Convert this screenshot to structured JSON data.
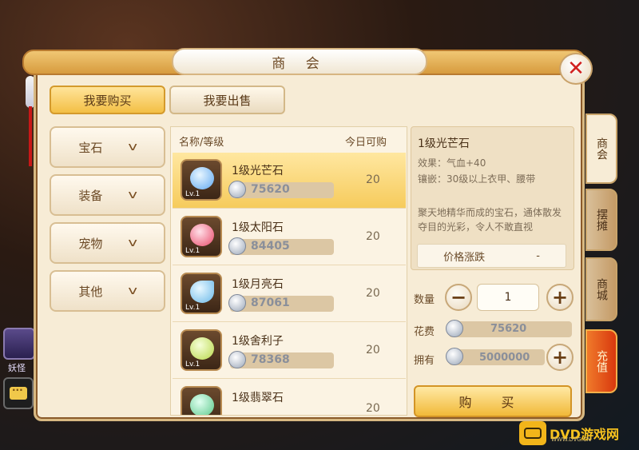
{
  "window": {
    "title": "商 会",
    "close_icon": "close-icon"
  },
  "top_tabs": {
    "buy": "我要购买",
    "sell": "我要出售"
  },
  "categories": [
    {
      "label": "宝石"
    },
    {
      "label": "装备"
    },
    {
      "label": "宠物"
    },
    {
      "label": "其他"
    }
  ],
  "list": {
    "header_name": "名称/等级",
    "header_qty": "今日可购",
    "items": [
      {
        "name": "1级光芒石",
        "price": "75620",
        "qty": "20",
        "level": "Lv.1",
        "color": "#5fa8f0"
      },
      {
        "name": "1级太阳石",
        "price": "84405",
        "qty": "20",
        "level": "Lv.1",
        "color": "#e84a6a"
      },
      {
        "name": "1级月亮石",
        "price": "87061",
        "qty": "20",
        "level": "Lv.1",
        "color": "#6ab8e8"
      },
      {
        "name": "1级舍利子",
        "price": "78368",
        "qty": "20",
        "level": "Lv.1",
        "color": "#b8d84a"
      },
      {
        "name": "1级翡翠石",
        "price": "",
        "qty": "20",
        "level": "",
        "color": "#5ac88a"
      }
    ]
  },
  "detail": {
    "name": "1级光芒石",
    "effect": "效果：气血+40",
    "inlay": "镶嵌：30级以上衣甲、腰带",
    "desc": "聚天地精华而成的宝石，通体散发夺目的光彩，令人不敢直视",
    "trend_label": "价格涨跌",
    "trend_value": "-",
    "qty_label": "数量",
    "qty_value": "1",
    "cost_label": "花费",
    "cost_value": "75620",
    "own_label": "拥有",
    "own_value": "5000000",
    "buy_label": "购 买"
  },
  "side_tabs": [
    {
      "label": "商会"
    },
    {
      "label": "摆摊"
    },
    {
      "label": "商城"
    },
    {
      "label": "充值"
    }
  ],
  "background": {
    "avatar_label": "妖怪",
    "chat_icon": "chat-icon"
  },
  "watermark": {
    "text": "DVD游戏网",
    "url": "WWW.DVG.CN"
  }
}
